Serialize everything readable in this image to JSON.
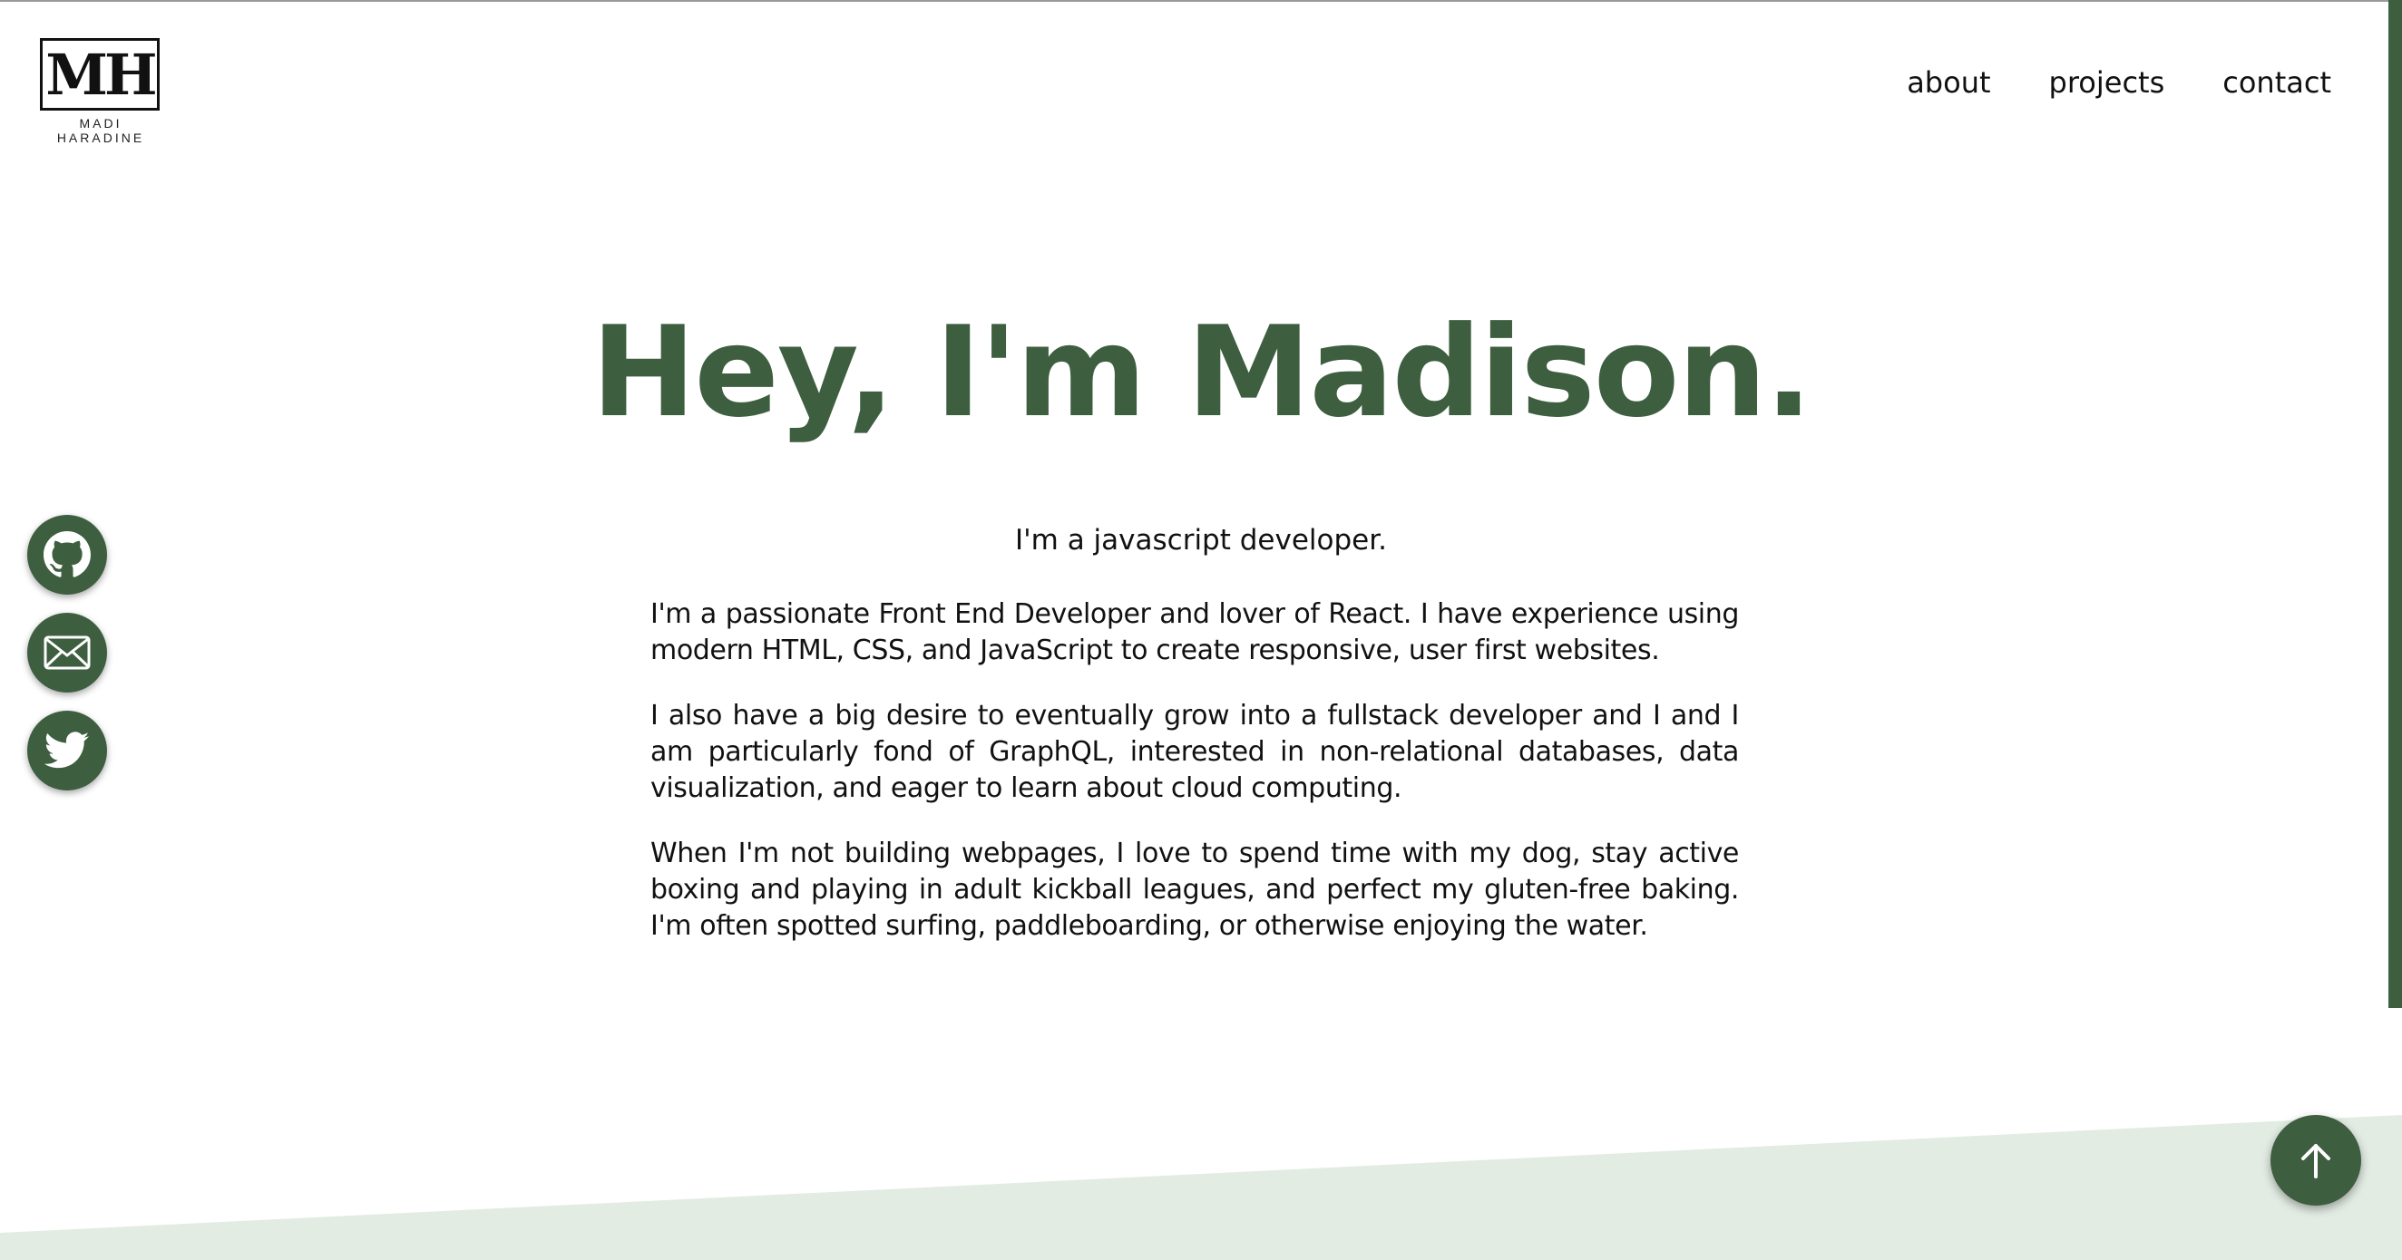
{
  "colors": {
    "accent": "#3e5e40",
    "band": "#e2ece3",
    "text": "#111111"
  },
  "logo": {
    "monogram": "MH",
    "name": "MADI HARADINE"
  },
  "nav": {
    "items": [
      "about",
      "projects",
      "contact"
    ]
  },
  "hero": {
    "title": "Hey, I'm Madison.",
    "subtitle": "I'm a javascript developer.",
    "paragraphs": [
      "I'm a passionate Front End Developer and lover of React. I have experience using modern HTML, CSS, and JavaScript to create responsive, user first websites.",
      "I also have a big desire to eventually grow into a fullstack developer and I and I am particularly fond of GraphQL, interested in non-relational databases, data visualization, and eager to learn about cloud computing.",
      "When I'm not building webpages, I love to spend time with my dog, stay active boxing and playing in adult kickball leagues, and perfect my gluten-free baking. I'm often spotted surfing, paddleboarding, or otherwise enjoying the water."
    ]
  },
  "social": {
    "icons": [
      "github-icon",
      "mail-icon",
      "twitter-icon"
    ]
  },
  "back_to_top": {
    "icon": "arrow-up-icon"
  }
}
